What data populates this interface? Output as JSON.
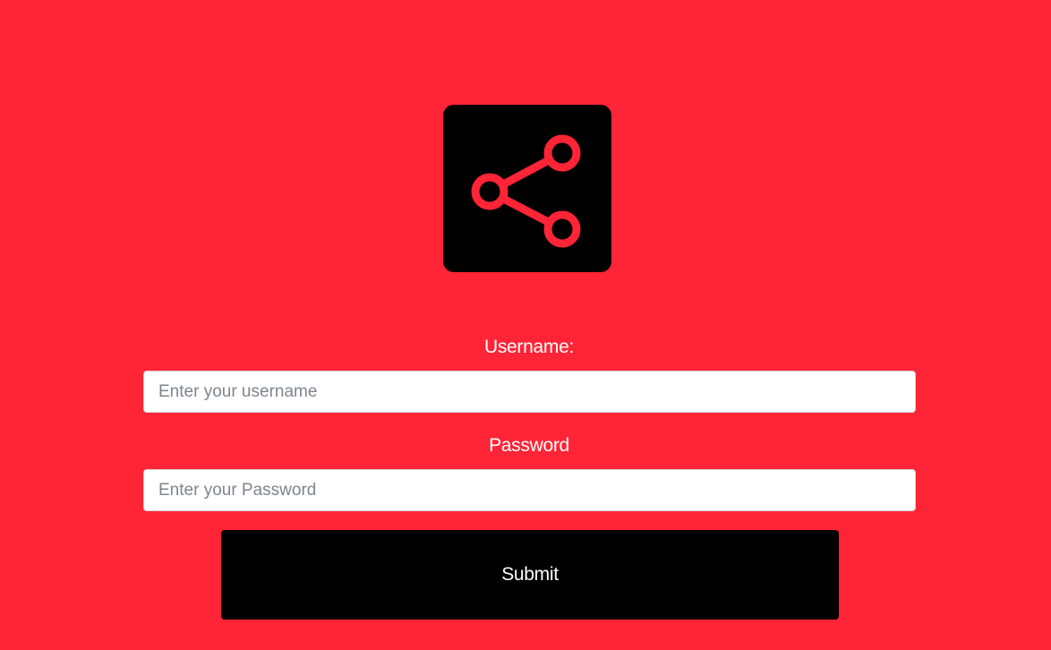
{
  "logo": {
    "icon": "share-icon",
    "background": "#000000",
    "icon_color": "#FF2436"
  },
  "form": {
    "username_label": "Username:",
    "username_placeholder": "Enter your username",
    "username_value": "",
    "password_label": "Password",
    "password_placeholder": "Enter your Password",
    "password_value": "",
    "submit_label": "Submit"
  },
  "colors": {
    "page_background": "#FF2436",
    "button_background": "#000000",
    "label_text": "#FFFFFF"
  }
}
